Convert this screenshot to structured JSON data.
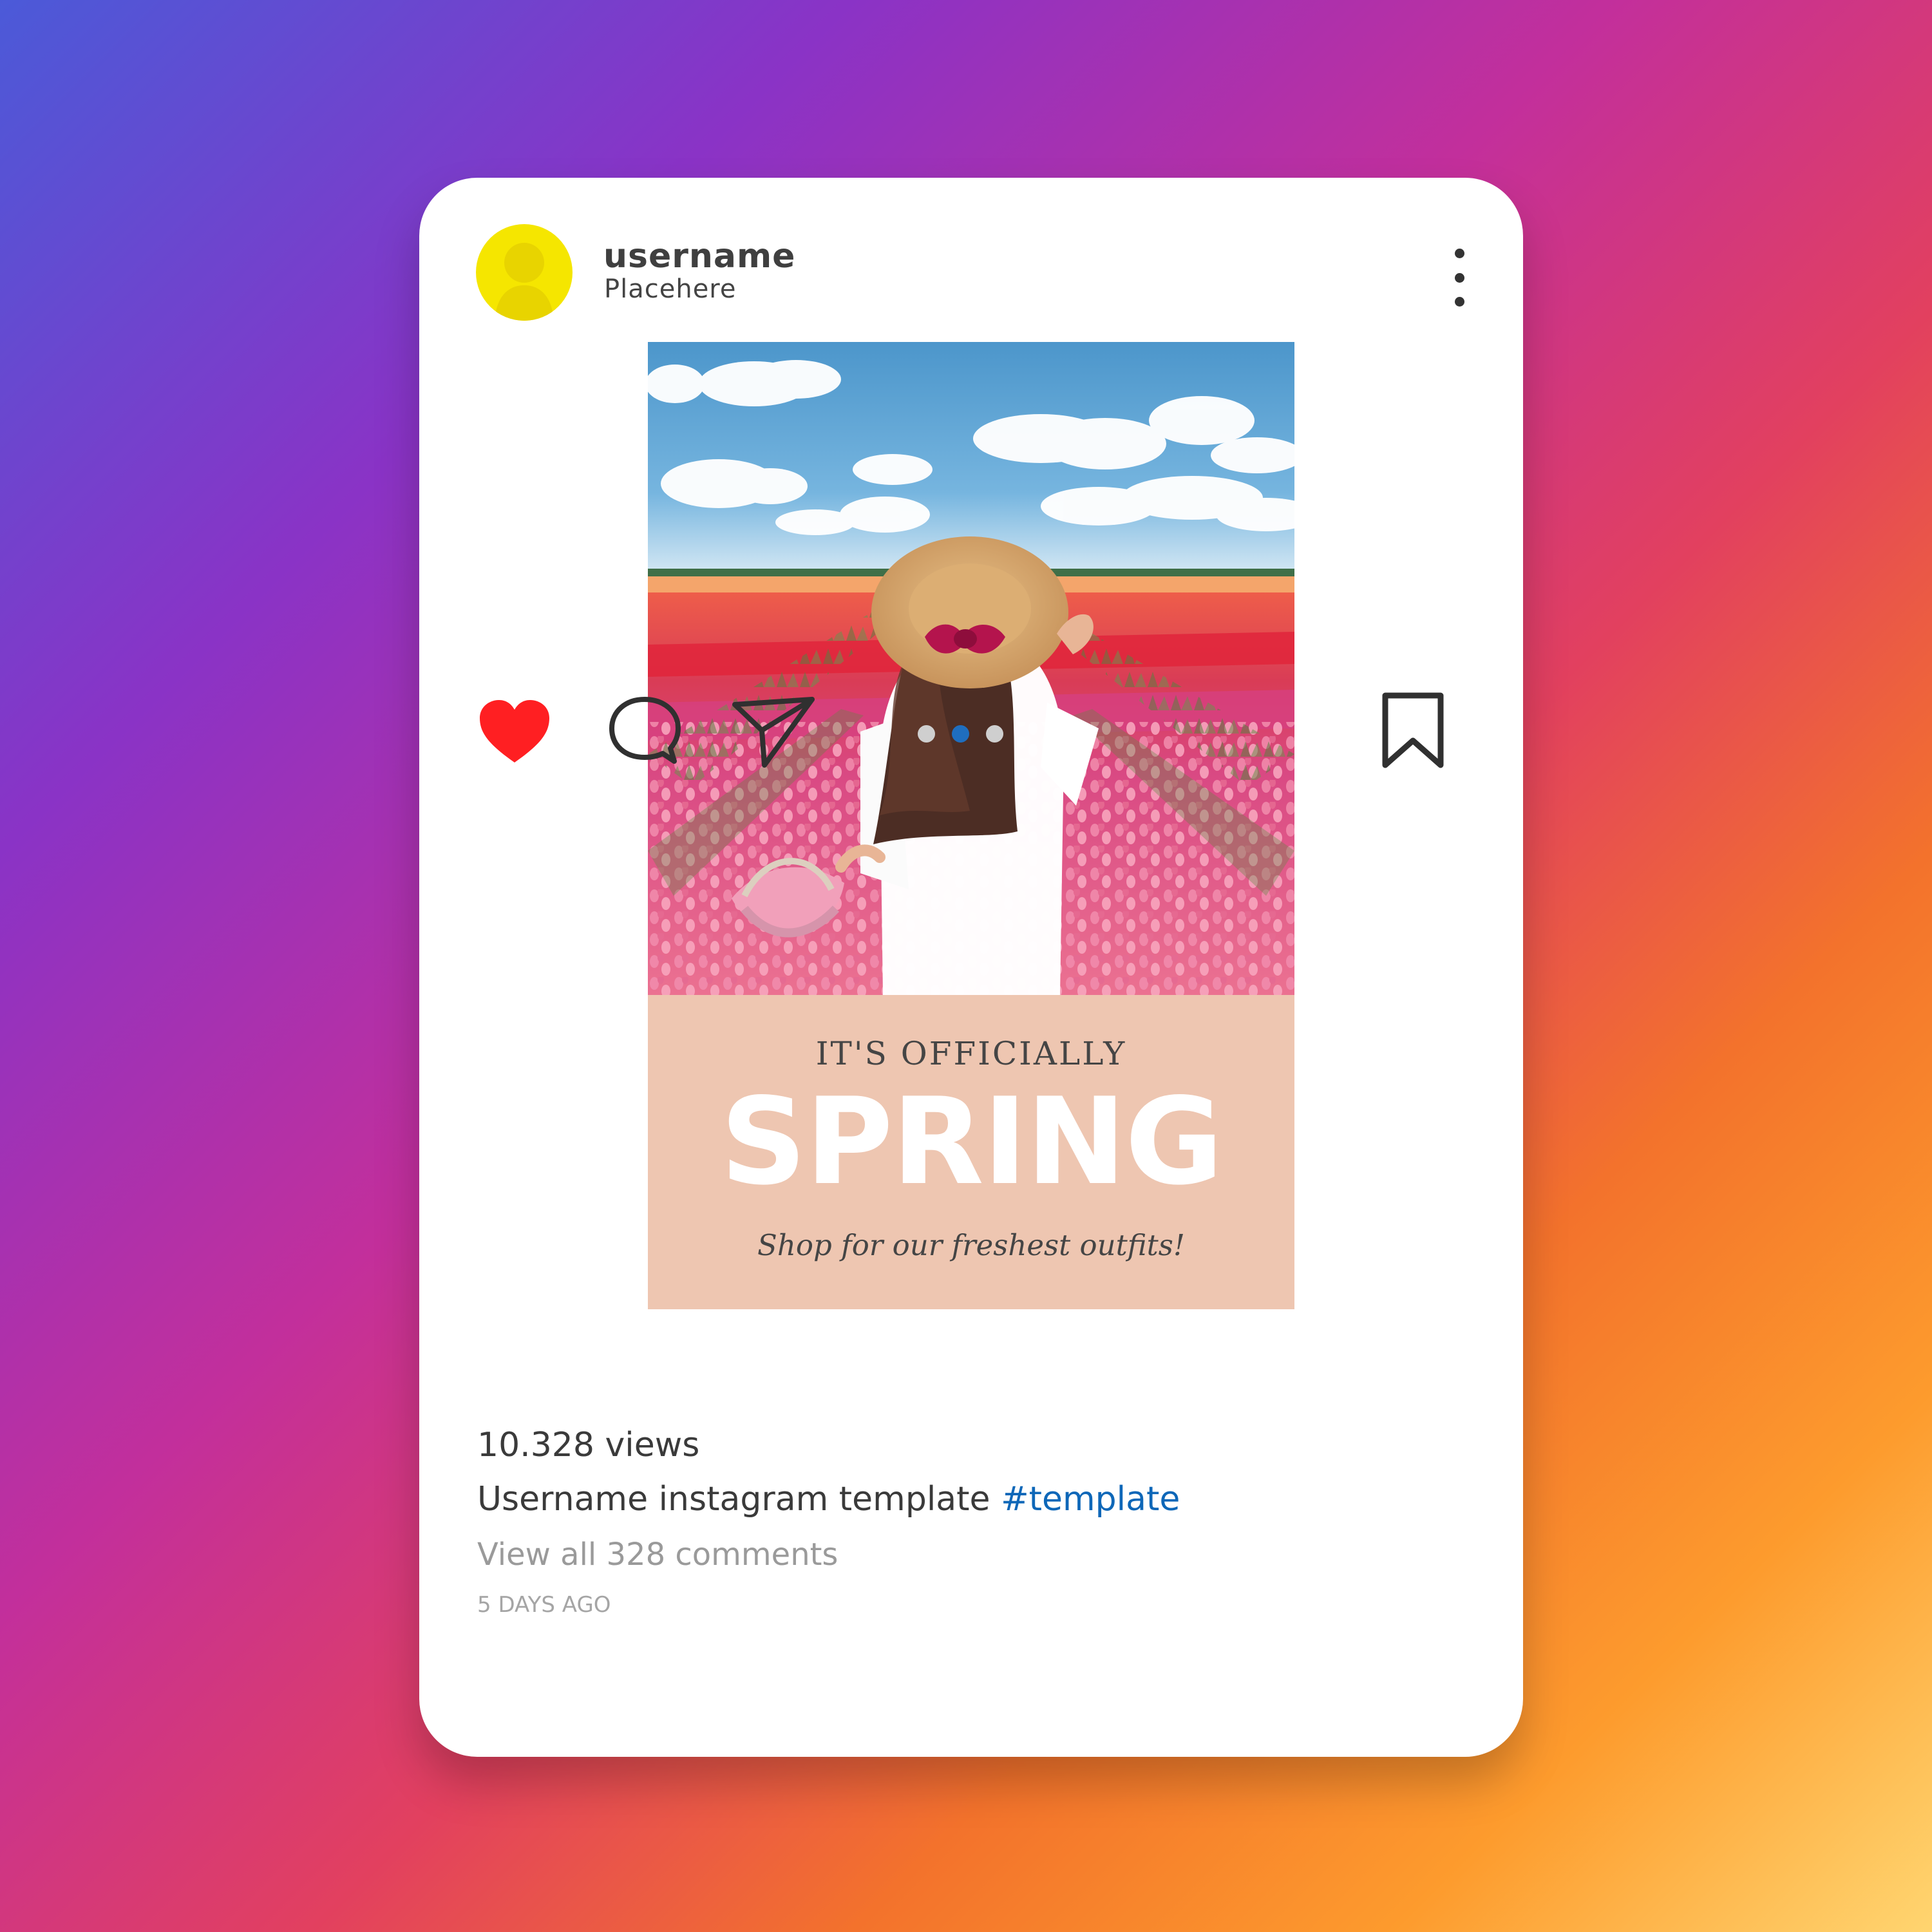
{
  "post": {
    "username": "username",
    "location": "Placehere",
    "views": "10.328 views",
    "caption": {
      "username": "Username",
      "text": "instagram template",
      "hashtag": "#template"
    },
    "comments_link": "View all 328 comments",
    "timestamp": "5 DAYS AGO",
    "media_count": 3,
    "active_media_index": 2
  },
  "promo": {
    "kicker": "IT'S OFFICIALLY",
    "headline": "SPRING",
    "tagline": "Shop for our freshest outfits!"
  },
  "icons": {
    "like": "heart-icon",
    "comment": "comment-icon",
    "share": "send-icon",
    "save": "bookmark-icon",
    "more": "more-vertical-icon",
    "avatar": "user-avatar-icon"
  },
  "colors": {
    "avatar": "#f5e600",
    "like": "#ff1f22",
    "hashtag": "#0e67b8",
    "active_dot": "#1f6ebf",
    "promo_background": "#eec6b1"
  }
}
